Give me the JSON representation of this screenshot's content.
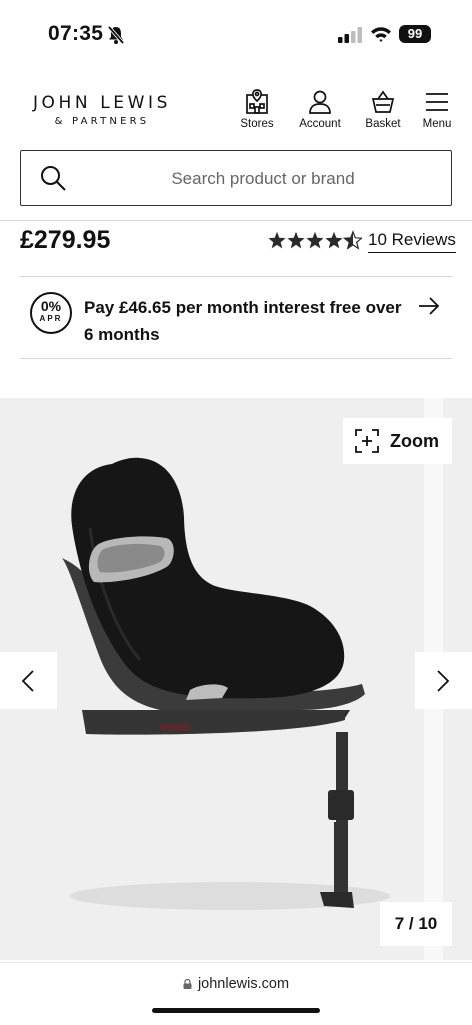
{
  "status_bar": {
    "time": "07:35",
    "battery": "99",
    "icons": [
      "bell-muted-icon",
      "signal-icon",
      "wifi-icon",
      "battery-icon"
    ]
  },
  "header": {
    "logo_main": "JOHN LEWIS",
    "logo_sub": "& PARTNERS",
    "nav": [
      {
        "label": "Stores",
        "icon": "store-icon"
      },
      {
        "label": "Account",
        "icon": "account-icon"
      },
      {
        "label": "Basket",
        "icon": "basket-icon"
      },
      {
        "label": "Menu",
        "icon": "menu-icon"
      }
    ]
  },
  "search": {
    "placeholder": "Search product or brand",
    "icon": "search-icon"
  },
  "product": {
    "price": "£279.95",
    "rating": 4.5,
    "rating_max": 5,
    "reviews_label": "10 Reviews"
  },
  "finance": {
    "badge_top": "0%",
    "badge_bottom": "APR",
    "text": "Pay £46.65 per month interest free over 6 months",
    "arrow_icon": "arrow-right-icon"
  },
  "gallery": {
    "zoom_label": "Zoom",
    "counter": "7 / 10",
    "image_alt": "Car seat product image",
    "seat_brand": "cybex",
    "colors": {
      "background": "#efefef",
      "seat": "#161616",
      "base": "#3b3b3b"
    }
  },
  "browser": {
    "url": "johnlewis.com"
  }
}
